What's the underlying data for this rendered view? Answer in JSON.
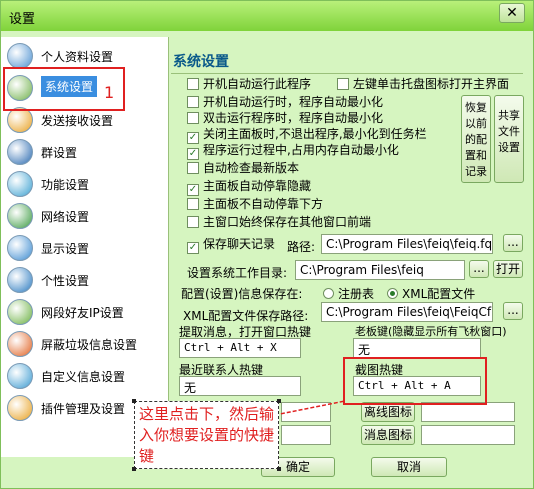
{
  "window": {
    "title": "设置",
    "close_glyph": "✕"
  },
  "sidebar": {
    "items": [
      {
        "label": "个人资料设置",
        "icon": "person-icon",
        "color": "#4a8fd0"
      },
      {
        "label": "系统设置",
        "icon": "system-icon",
        "color": "#6fb04a"
      },
      {
        "label": "发送接收设置",
        "icon": "send-receive-icon",
        "color": "#e8a020"
      },
      {
        "label": "群设置",
        "icon": "group-icon",
        "color": "#2a6ab0"
      },
      {
        "label": "功能设置",
        "icon": "function-icon",
        "color": "#3aa0d0"
      },
      {
        "label": "网络设置",
        "icon": "network-icon",
        "color": "#3a9a40"
      },
      {
        "label": "显示设置",
        "icon": "display-icon",
        "color": "#3a8ad0"
      },
      {
        "label": "个性设置",
        "icon": "personalize-icon",
        "color": "#2a7ac0"
      },
      {
        "label": "网段好友IP设置",
        "icon": "segment-icon",
        "color": "#6ab040"
      },
      {
        "label": "屏蔽垃圾信息设置",
        "icon": "block-icon",
        "color": "#e06020"
      },
      {
        "label": "自定义信息设置",
        "icon": "custom-info-icon",
        "color": "#3a9ad0"
      },
      {
        "label": "插件管理及设置",
        "icon": "plugin-icon",
        "color": "#e8a020"
      }
    ],
    "annotation_number": "1"
  },
  "panel": {
    "title": "系统设置",
    "checkboxes": [
      {
        "label": "开机自动运行此程序",
        "checked": false
      },
      {
        "label": "左键单击托盘图标打开主界面",
        "checked": false
      },
      {
        "label": "开机自动运行时，程序自动最小化",
        "checked": false
      },
      {
        "label": "双击运行程序时，程序自动最小化",
        "checked": false
      },
      {
        "label": "关闭主面板时,不退出程序,最小化到任务栏",
        "checked": true
      },
      {
        "label": "程序运行过程中,占用内存自动最小化",
        "checked": true
      },
      {
        "label": "自动检查最新版本",
        "checked": false
      },
      {
        "label": "主面板自动停靠隐藏",
        "checked": true
      },
      {
        "label": "主面板不自动停靠下方",
        "checked": false
      },
      {
        "label": "主窗口始终保存在其他窗口前端",
        "checked": false
      },
      {
        "label": "保存聊天记录",
        "checked": true
      }
    ],
    "restore_button": "恢复以前的配置和记录",
    "share_button": "共享文件设置",
    "path_label": "路径:",
    "path_value": "C:\\Program Files\\feiq\\feiq.fq",
    "browse_label": "...",
    "workdir_label": "设置系统工作目录:",
    "workdir_value": "C:\\Program Files\\feiq",
    "open_label": "打开",
    "config_save_label": "配置(设置)信息保存在:",
    "radio_registry": "注册表",
    "radio_xml": "XML配置文件",
    "xml_path_label": "XML配置文件保存路径:",
    "xml_path_value": "C:\\Program Files\\feiq\\FeiqCf",
    "hotkey_extract_label": "提取消息，打开窗口热键",
    "hotkey_extract_value": "Ctrl + Alt + X",
    "boss_key_label": "老板键(隐藏显示所有飞秋窗口)",
    "boss_key_value": "无",
    "recent_contact_label": "最近联系人热键",
    "recent_contact_value": "无",
    "screenshot_label": "截图热键",
    "screenshot_value": "Ctrl + Alt + A",
    "offline_icon_label": "离线图标",
    "message_icon_label": "消息图标",
    "ok_label": "确定",
    "cancel_label": "取消"
  },
  "annotation": {
    "text": "这里点击下，然后输入你想要设置的快捷键"
  },
  "colors": {
    "accent": "#3a8ee0",
    "annotation_red": "#e02020",
    "panel_bg": "#d6f5c0"
  }
}
